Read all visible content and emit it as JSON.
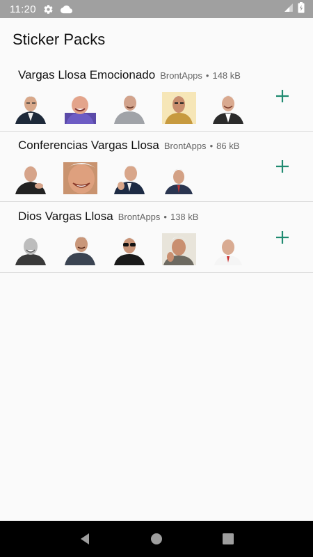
{
  "status_bar": {
    "time": "11:20",
    "icons": [
      "gear-icon",
      "cloud-icon",
      "signal-icon",
      "battery-charging-icon"
    ]
  },
  "app": {
    "title": "Sticker Packs"
  },
  "packs": [
    {
      "name": "Vargas Llosa Emocionado",
      "publisher": "BrontApps",
      "separator": "•",
      "size": "148 kB",
      "sticker_count": 5
    },
    {
      "name": "Conferencias Vargas Llosa",
      "publisher": "BrontApps",
      "separator": "•",
      "size": "86 kB",
      "sticker_count": 4
    },
    {
      "name": "Dios Vargas Llosa",
      "publisher": "BrontApps",
      "separator": "•",
      "size": "138 kB",
      "sticker_count": 5
    }
  ],
  "colors": {
    "accent": "#1f8a70",
    "status_bar_bg": "#a0a0a0",
    "divider": "#dcdcdc",
    "nav_bar_bg": "#000000"
  },
  "nav_bar": {
    "icons": [
      "back-icon",
      "home-icon",
      "recents-icon"
    ]
  }
}
